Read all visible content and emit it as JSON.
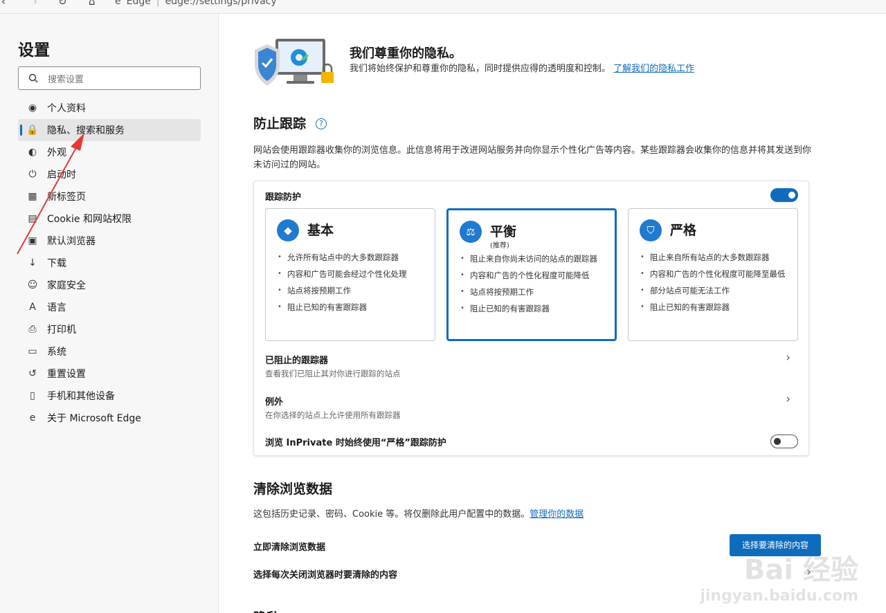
{
  "browser": {
    "site_label": "Edge",
    "separator": "|",
    "url": "edge://settings/privacy"
  },
  "sidebar": {
    "title": "设置",
    "search_placeholder": "搜索设置",
    "items": [
      {
        "label": "个人资料",
        "icon": "profile-icon",
        "active": false
      },
      {
        "label": "隐私、搜索和服务",
        "icon": "lock-icon",
        "active": true
      },
      {
        "label": "外观",
        "icon": "appearance-icon",
        "active": false
      },
      {
        "label": "启动时",
        "icon": "power-icon",
        "active": false
      },
      {
        "label": "新标签页",
        "icon": "new-tab-icon",
        "active": false
      },
      {
        "label": "Cookie 和网站权限",
        "icon": "cookie-icon",
        "active": false
      },
      {
        "label": "默认浏览器",
        "icon": "default-browser-icon",
        "active": false
      },
      {
        "label": "下载",
        "icon": "download-icon",
        "active": false
      },
      {
        "label": "家庭安全",
        "icon": "family-icon",
        "active": false
      },
      {
        "label": "语言",
        "icon": "language-icon",
        "active": false
      },
      {
        "label": "打印机",
        "icon": "printer-icon",
        "active": false
      },
      {
        "label": "系统",
        "icon": "laptop-icon",
        "active": false
      },
      {
        "label": "重置设置",
        "icon": "reset-icon",
        "active": false
      },
      {
        "label": "手机和其他设备",
        "icon": "phone-icon",
        "active": false
      },
      {
        "label": "关于 Microsoft Edge",
        "icon": "edge-logo-icon",
        "active": false
      }
    ]
  },
  "privacy_header": {
    "title": "我们尊重你的隐私。",
    "text": "我们将始终保护和尊重你的隐私，同时提供应得的透明度和控制。",
    "link": "了解我们的隐私工作"
  },
  "tracking": {
    "title": "防止跟踪",
    "description": "网站会使用跟踪器收集你的浏览信息。此信息将用于改进网站服务并向你显示个性化广告等内容。某些跟踪器会收集你的信息并将其发送到你未访问过的网站。",
    "toggle_label": "跟踪防护",
    "toggle_on": true,
    "options": [
      {
        "title": "基本",
        "subtitle": "",
        "selected": false,
        "points": [
          "允许所有站点中的大多数跟踪器",
          "内容和广告可能会经过个性化处理",
          "站点将按预期工作",
          "阻止已知的有害跟踪器"
        ]
      },
      {
        "title": "平衡",
        "subtitle": "(推荐)",
        "selected": true,
        "points": [
          "阻止来自你尚未访问的站点的跟踪器",
          "内容和广告的个性化程度可能降低",
          "站点将按预期工作",
          "阻止已知的有害跟踪器"
        ]
      },
      {
        "title": "严格",
        "subtitle": "",
        "selected": false,
        "points": [
          "阻止来自所有站点的大多数跟踪器",
          "内容和广告的个性化程度可能降至最低",
          "部分站点可能无法工作",
          "阻止已知的有害跟踪器"
        ]
      }
    ],
    "blocked": {
      "title": "已阻止的跟踪器",
      "sub": "查看我们已阻止其对你进行跟踪的站点"
    },
    "exceptions": {
      "title": "例外",
      "sub": "在你选择的站点上允许使用所有跟踪器"
    },
    "inprivate": {
      "label": "浏览 InPrivate 时始终使用“严格”跟踪防护",
      "on": false
    }
  },
  "clear": {
    "title": "清除浏览数据",
    "text": "这包括历史记录、密码、Cookie 等。将仅删除此用户配置中的数据。",
    "link": "管理你的数据",
    "now_label": "立即清除浏览数据",
    "button": "选择要清除的内容",
    "on_close": "选择每次关闭浏览器时要清除的内容",
    "next_partial": "隐私"
  },
  "watermark": {
    "brand": "Bai 经验",
    "url": "jingyan.baidu.com"
  },
  "colors": {
    "accent": "#0f6cbd",
    "annotation": "#e53935"
  }
}
